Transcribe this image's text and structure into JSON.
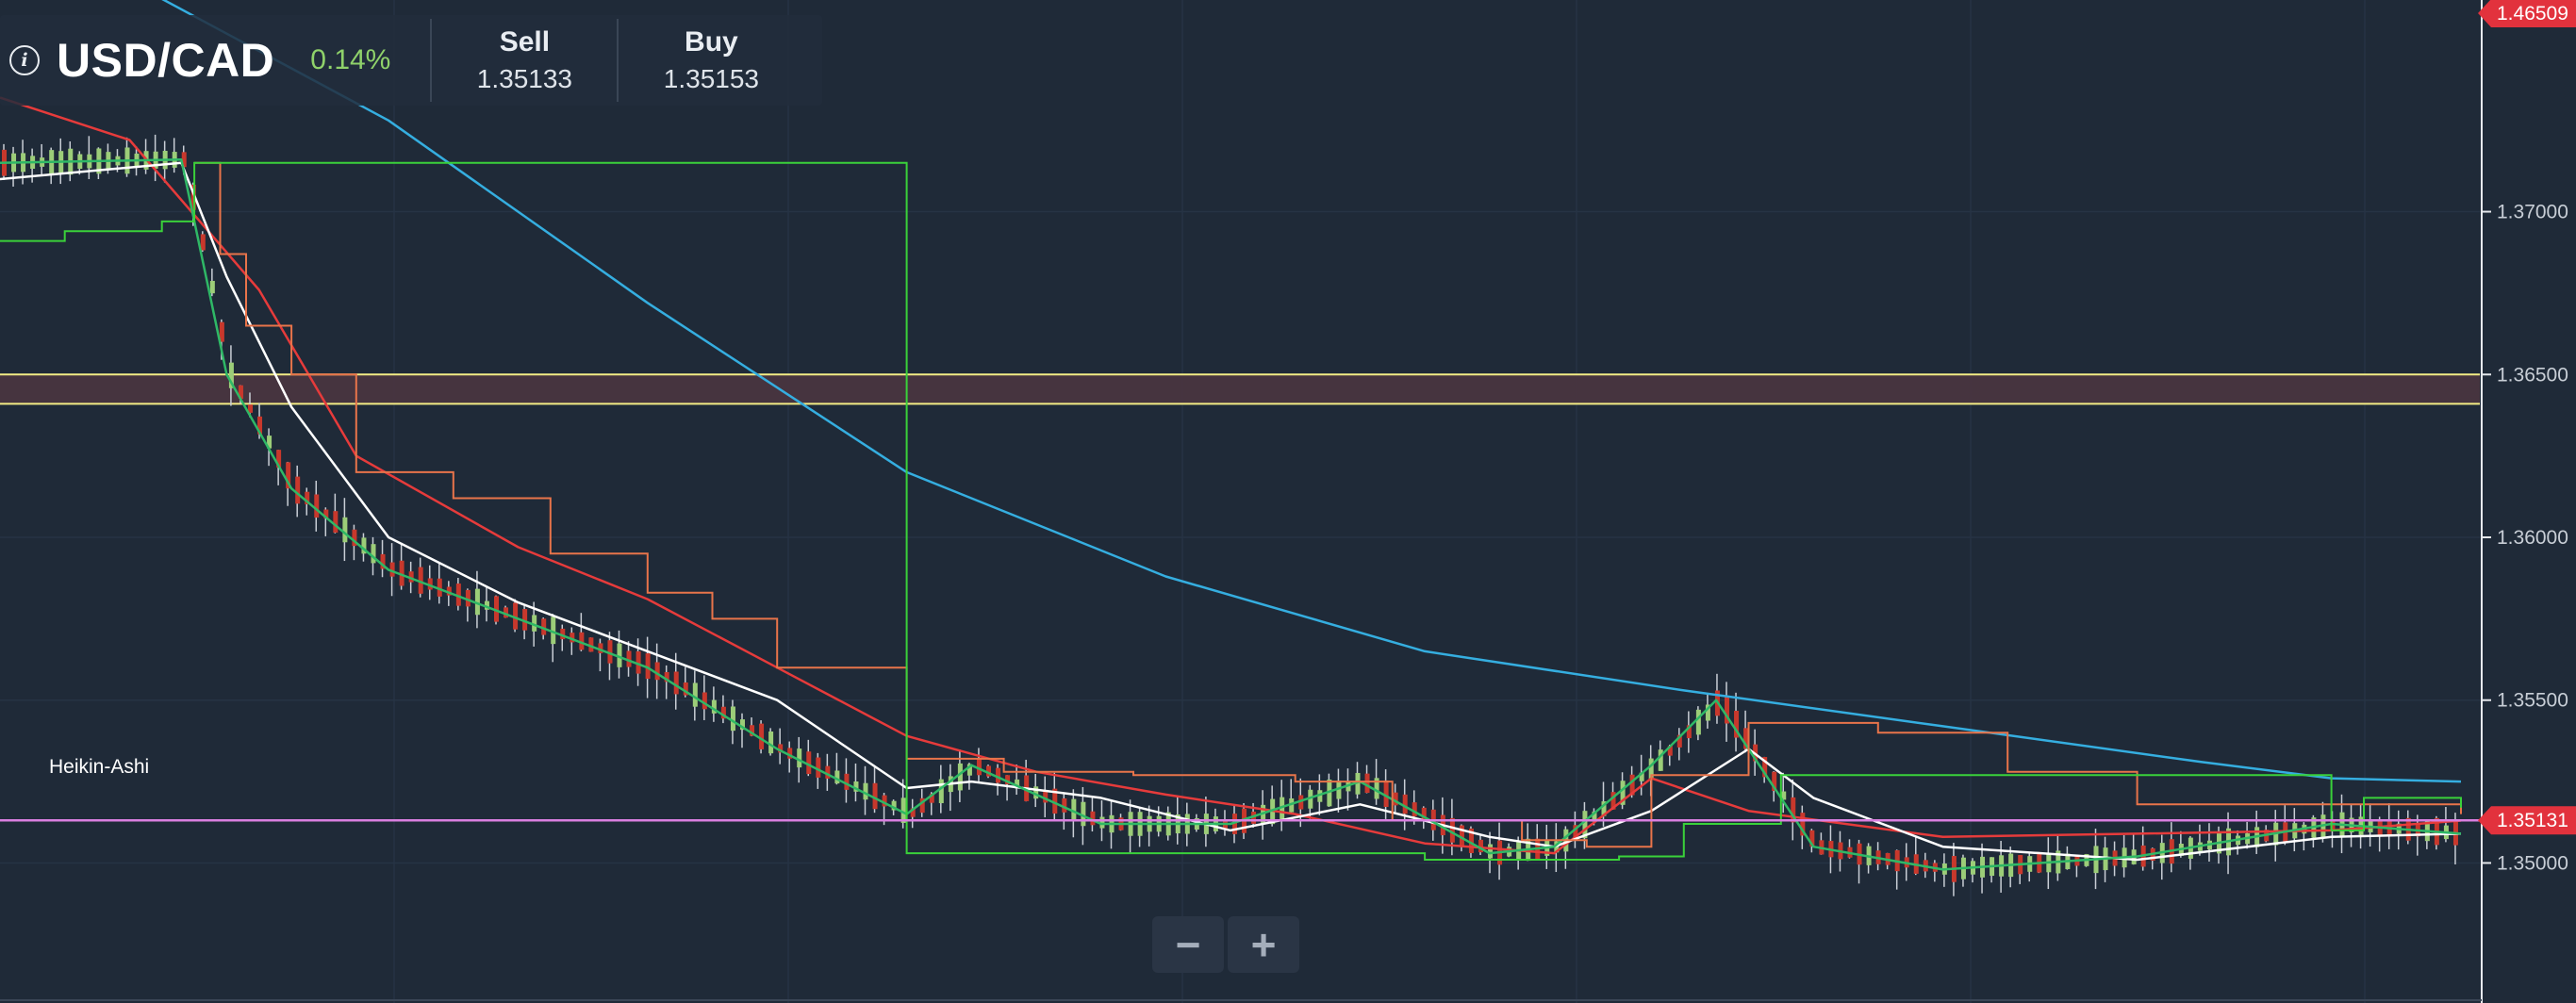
{
  "header": {
    "info_icon": "info-icon",
    "symbol": "USD/CAD",
    "change": "0.14%",
    "sell_label": "Sell",
    "sell_value": "1.35133",
    "buy_label": "Buy",
    "buy_value": "1.35153"
  },
  "zoom": {
    "minus": "−",
    "plus": "+"
  },
  "indicator_label": "Heikin-Ashi",
  "colors": {
    "background": "#1f2a38",
    "bull_candle": "#9ccd78",
    "bear_candle": "#c8382c",
    "ma_blue": "#35aee0",
    "ma_red": "#e63b3b",
    "ma_white": "#ffffff",
    "ma_green": "#2fb866",
    "stop_orange": "#e8744a",
    "stop_green": "#3ad13a",
    "zone_fill": "#4a3540",
    "zone_border": "#f3ec85",
    "price_line": "#d97fe0",
    "badge": "#e2323d"
  },
  "chart_data": {
    "type": "candlestick",
    "y_axis": {
      "ticks": [
        "1.37000",
        "1.36500",
        "1.36000",
        "1.35500",
        "1.35000"
      ],
      "tick_values": [
        1.37,
        1.365,
        1.36,
        1.355,
        1.35
      ],
      "range": [
        1.3457,
        1.3765
      ]
    },
    "top_badge": "1.46509",
    "current_price_badge": "1.35131",
    "current_price": 1.35131,
    "zone": {
      "top": 1.365,
      "bottom": 1.3641
    },
    "candle_count": 260,
    "series": [
      {
        "key": "blue",
        "points": [
          [
            0,
            1.3792
          ],
          [
            60,
            1.3728
          ],
          [
            100,
            1.3672
          ],
          [
            140,
            1.362
          ],
          [
            180,
            1.3588
          ],
          [
            220,
            1.3565
          ],
          [
            260,
            1.3553
          ],
          [
            300,
            1.3542
          ],
          [
            340,
            1.3531
          ],
          [
            360,
            1.3526
          ],
          [
            380,
            1.3525
          ]
        ]
      },
      {
        "key": "red",
        "points": [
          [
            0,
            1.3735
          ],
          [
            20,
            1.3722
          ],
          [
            40,
            1.3676
          ],
          [
            55,
            1.3625
          ],
          [
            80,
            1.3597
          ],
          [
            100,
            1.3581
          ],
          [
            120,
            1.356
          ],
          [
            140,
            1.3539
          ],
          [
            160,
            1.3528
          ],
          [
            180,
            1.3521
          ],
          [
            200,
            1.3515
          ],
          [
            220,
            1.3506
          ],
          [
            240,
            1.3503
          ],
          [
            255,
            1.3526
          ],
          [
            270,
            1.3516
          ],
          [
            300,
            1.3508
          ],
          [
            330,
            1.3509
          ],
          [
            360,
            1.351
          ],
          [
            380,
            1.3513
          ]
        ]
      },
      {
        "key": "white",
        "points": [
          [
            0,
            1.371
          ],
          [
            28,
            1.3715
          ],
          [
            35,
            1.368
          ],
          [
            45,
            1.364
          ],
          [
            60,
            1.36
          ],
          [
            80,
            1.358
          ],
          [
            100,
            1.3565
          ],
          [
            120,
            1.355
          ],
          [
            140,
            1.3523
          ],
          [
            150,
            1.3525
          ],
          [
            170,
            1.352
          ],
          [
            190,
            1.351
          ],
          [
            210,
            1.3518
          ],
          [
            230,
            1.3508
          ],
          [
            240,
            1.3505
          ],
          [
            255,
            1.3516
          ],
          [
            270,
            1.3535
          ],
          [
            280,
            1.352
          ],
          [
            300,
            1.3505
          ],
          [
            330,
            1.3501
          ],
          [
            360,
            1.3508
          ],
          [
            380,
            1.3509
          ]
        ]
      },
      {
        "key": "green",
        "points": [
          [
            0,
            1.3715
          ],
          [
            28,
            1.3716
          ],
          [
            35,
            1.365
          ],
          [
            45,
            1.3615
          ],
          [
            60,
            1.359
          ],
          [
            80,
            1.3575
          ],
          [
            100,
            1.356
          ],
          [
            120,
            1.3535
          ],
          [
            140,
            1.3515
          ],
          [
            150,
            1.353
          ],
          [
            170,
            1.3512
          ],
          [
            190,
            1.3512
          ],
          [
            210,
            1.3525
          ],
          [
            230,
            1.3503
          ],
          [
            240,
            1.3505
          ],
          [
            255,
            1.353
          ],
          [
            265,
            1.355
          ],
          [
            280,
            1.3505
          ],
          [
            300,
            1.3498
          ],
          [
            330,
            1.3502
          ],
          [
            360,
            1.3512
          ],
          [
            380,
            1.3509
          ]
        ]
      }
    ],
    "trailing_stops": [
      {
        "key": "orange",
        "points": [
          [
            30,
            1.3715
          ],
          [
            34,
            1.3687
          ],
          [
            38,
            1.3665
          ],
          [
            45,
            1.365
          ],
          [
            55,
            1.362
          ],
          [
            70,
            1.3612
          ],
          [
            85,
            1.3595
          ],
          [
            100,
            1.3583
          ],
          [
            110,
            1.3575
          ],
          [
            120,
            1.356
          ],
          [
            140,
            1.3532
          ],
          [
            155,
            1.3528
          ],
          [
            175,
            1.3527
          ],
          [
            200,
            1.3525
          ],
          [
            215,
            1.3513
          ],
          [
            235,
            1.3507
          ],
          [
            245,
            1.3505
          ],
          [
            255,
            1.3527
          ],
          [
            270,
            1.3543
          ],
          [
            290,
            1.354
          ],
          [
            310,
            1.3528
          ],
          [
            330,
            1.3518
          ],
          [
            360,
            1.3518
          ],
          [
            380,
            1.3515
          ]
        ]
      },
      {
        "key": "green_stop",
        "points": [
          [
            0,
            1.3691
          ],
          [
            10,
            1.3694
          ],
          [
            25,
            1.3697
          ],
          [
            30,
            1.3715
          ],
          [
            34,
            1.3715
          ],
          [
            140,
            1.3503
          ],
          [
            160,
            1.3503
          ],
          [
            220,
            1.3501
          ],
          [
            240,
            1.3501
          ],
          [
            250,
            1.3502
          ],
          [
            260,
            1.3512
          ],
          [
            275,
            1.3527
          ],
          [
            280,
            1.3527
          ],
          [
            360,
            1.351
          ],
          [
            365,
            1.352
          ],
          [
            372,
            1.352
          ],
          [
            380,
            1.3517
          ]
        ]
      }
    ]
  }
}
